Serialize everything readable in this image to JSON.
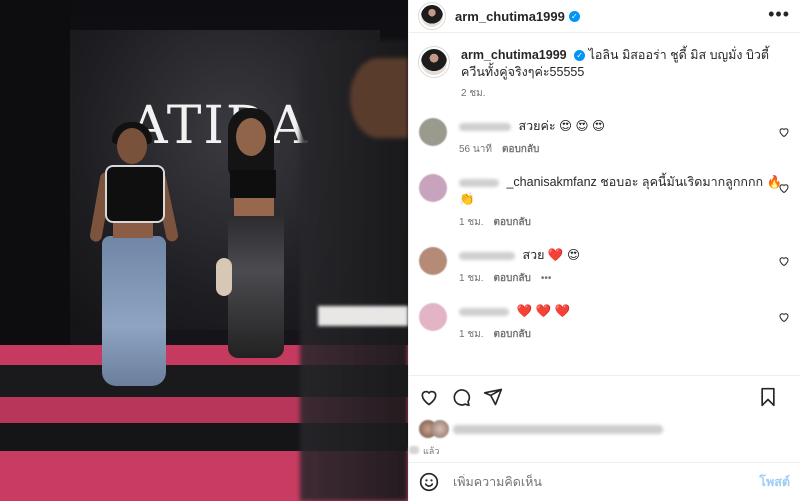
{
  "post": {
    "username": "arm_chutima1999",
    "verified_icon": "verified-badge-icon",
    "more_icon": "more-horizontal-icon",
    "more_label": "•••",
    "brand_logo_text": "ATIDA"
  },
  "caption": {
    "username": "arm_chutima1999",
    "text": "ไอลิน มิสออร่า ชูดี้ มิส บญมั่ง บิวตี้ควีนทั้งคู่จริงๆค่ะ55555",
    "time": "2 ชม."
  },
  "comments": [
    {
      "text": "สวยค่ะ 😍 😍 😍",
      "time": "56 นาที",
      "reply": "ตอบกลับ",
      "avatar_color": "#9a9a8e"
    },
    {
      "text": "_chanisakmfanz ชอบอะ ลุคนี้มันเริดมากลูกกกก 🔥 👏",
      "time": "1 ชม.",
      "reply": "ตอบกลับ",
      "avatar_color": "#c7a3bd"
    },
    {
      "text": "สวย ❤️ 😍",
      "time": "1 ชม.",
      "reply": "ตอบกลับ",
      "extra": "•••",
      "avatar_color": "#b58b78"
    },
    {
      "text": "❤️ ❤️ ❤️",
      "time": "1 ชม.",
      "reply": "ตอบกลับ",
      "avatar_color": "#e3b3c6"
    }
  ],
  "likes": {
    "ago": "แล้ว"
  },
  "composer": {
    "placeholder": "เพิ่มความคิดเห็น",
    "post_label": "โพสต์"
  },
  "colors": {
    "accent": "#0095f6",
    "post_button": "#9ecdf5",
    "stage_pink": "#c73a5f"
  }
}
